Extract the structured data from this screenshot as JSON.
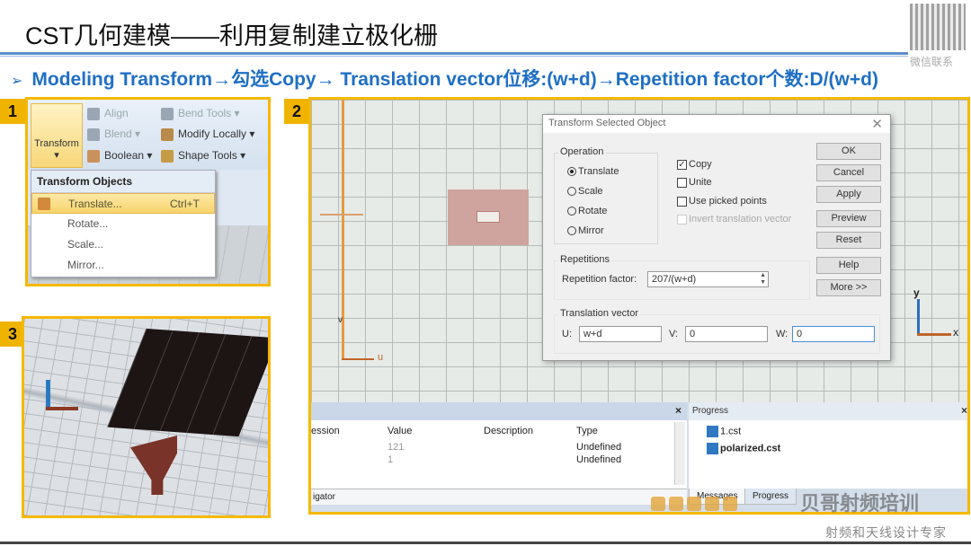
{
  "slide": {
    "title": "CST几何建模——利用复制建立极化栅",
    "subtitle": "Modeling Transform→勾选Copy→ Translation vector位移:(w+d)→Repetition factor个数:D/(w+d)",
    "subtitle_bullet": "➢",
    "qr_caption": "微信联系",
    "watermark_brand": "贝哥射频培训",
    "watermark_caption": "射频和天线设计专家",
    "accent_color": "#f5b800",
    "subtitle_color": "#1f6fc4"
  },
  "panel1": {
    "number": "1",
    "ribbon": {
      "transform": "Transform",
      "transform_arrow": "▾",
      "align": "Align",
      "blend": "Blend ▾",
      "boolean": "Boolean ▾",
      "bend_tools": "Bend Tools ▾",
      "modify_locally": "Modify Locally ▾",
      "shape_tools": "Shape Tools ▾"
    },
    "menu": {
      "header": "Transform Objects",
      "items": [
        {
          "label": "Translate...",
          "shortcut": "Ctrl+T"
        },
        {
          "label": "Rotate..."
        },
        {
          "label": "Scale..."
        },
        {
          "label": "Mirror..."
        }
      ]
    }
  },
  "panel2": {
    "number": "2",
    "axis_labels": {
      "u": "u",
      "v": "v",
      "x": "x",
      "y": "y"
    },
    "dialog": {
      "title": "Transform Selected Object",
      "close": "✕",
      "operation_label": "Operation",
      "operations": [
        "Translate",
        "Scale",
        "Rotate",
        "Mirror"
      ],
      "selected_operation": "Translate",
      "options": [
        {
          "label": "Copy",
          "checked": true,
          "enabled": true
        },
        {
          "label": "Unite",
          "checked": false,
          "enabled": true
        },
        {
          "label": "Use picked points",
          "checked": false,
          "enabled": true
        },
        {
          "label": "Invert translation vector",
          "checked": false,
          "enabled": false
        }
      ],
      "buttons": [
        "OK",
        "Cancel",
        "Apply",
        "Preview",
        "Reset",
        "Help",
        "More >>"
      ],
      "repetitions_label": "Repetitions",
      "repetition_factor_label": "Repetition factor:",
      "repetition_factor_value": "207/(w+d)",
      "translation_label": "Translation vector",
      "u_label": "U:",
      "u_value": "w+d",
      "v_label": "V:",
      "v_value": "0",
      "w_label": "W:",
      "w_value": "0"
    },
    "params_table": {
      "columns": [
        "ession",
        "Value",
        "Description",
        "Type"
      ],
      "rows": [
        {
          "value": "121",
          "description": "",
          "type": "Undefined"
        },
        {
          "value": "1",
          "description": "",
          "type": "Undefined"
        }
      ],
      "navigator_label": "igator"
    },
    "progress": {
      "title": "Progress",
      "files": [
        "1.cst",
        "polarized.cst"
      ],
      "tabs": [
        "Messages",
        "Progress"
      ]
    }
  },
  "panel3": {
    "number": "3"
  }
}
